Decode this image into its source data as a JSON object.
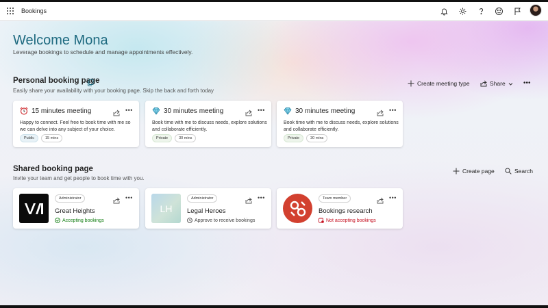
{
  "app": {
    "title": "Bookings"
  },
  "header_icons": [
    "bell-icon",
    "gear-icon",
    "help-icon",
    "smiley-icon",
    "flag-icon"
  ],
  "welcome": {
    "title": "Welcome Mona",
    "subtitle": "Leverage bookings to schedule and manage appointments effectively."
  },
  "personal": {
    "title": "Personal booking page",
    "subtitle": "Easily share your availability with your booking page. Skip the back and forth today",
    "create_label": "Create meeting type",
    "share_label": "Share",
    "more_label": "•••",
    "cards": [
      {
        "title": "15 minutes meeting",
        "icon": "alarm-clock-icon",
        "description": "Happy to connect. Feel free to book time with me so we can delve into any subject of your choice.",
        "visibility": "Public",
        "duration": "15 mins",
        "more": "•••"
      },
      {
        "title": "30 minutes meeting",
        "icon": "gem-icon",
        "description": "Book time with me to discuss needs, explore solutions and collaborate efficiently.",
        "visibility": "Private",
        "duration": "30 mins",
        "more": "•••"
      },
      {
        "title": "30 minutes meeting",
        "icon": "gem-icon",
        "description": "Book time with me to discuss needs, explore solutions and collaborate efficiently.",
        "visibility": "Private",
        "duration": "30 mins",
        "more": "•••"
      }
    ]
  },
  "shared": {
    "title": "Shared booking page",
    "subtitle": "Invite your team and get people to book time with you.",
    "create_label": "Create page",
    "search_label": "Search",
    "cards": [
      {
        "logo_text": "",
        "role": "Administrator",
        "name": "Great Heights",
        "status": "Accepting bookings",
        "status_color": "#107c10",
        "more": "•••"
      },
      {
        "logo_text": "LH",
        "role": "Administrator",
        "name": "Legal Heroes",
        "status": "Approve to receive bookings",
        "status_color": "#424242",
        "more": "•••"
      },
      {
        "logo_text": "",
        "role": "Team member",
        "name": "Bookings research",
        "status": "Not accepting bookings",
        "status_color": "#c50f1f",
        "more": "•••"
      }
    ]
  },
  "colors": {
    "accent": "#1e6a80",
    "success": "#107c10",
    "error": "#c50f1f",
    "brand_orange": "#d2402f"
  }
}
